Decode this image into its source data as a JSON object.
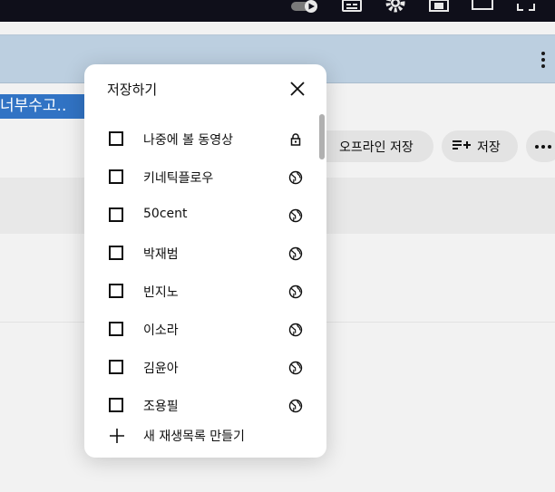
{
  "background": {
    "player_controls": [
      "miniplayer-icon",
      "subtitles-icon",
      "settings-gear-icon",
      "theater-mode-icon",
      "cast-icon",
      "fullscreen-icon"
    ],
    "video_title_fragment": "너부수고..",
    "chips": {
      "offline_save": "오프라인 저장",
      "save": "저장"
    }
  },
  "dialog": {
    "title": "저장하기",
    "close_icon": "close-icon",
    "playlists": [
      {
        "label": "나중에 볼 동영상",
        "checked": false,
        "privacy_icon": "lock-icon"
      },
      {
        "label": "키네틱플로우",
        "checked": false,
        "privacy_icon": "globe-icon"
      },
      {
        "label": "50cent",
        "checked": false,
        "privacy_icon": "globe-icon"
      },
      {
        "label": "박재범",
        "checked": false,
        "privacy_icon": "globe-icon"
      },
      {
        "label": "빈지노",
        "checked": false,
        "privacy_icon": "globe-icon"
      },
      {
        "label": "이소라",
        "checked": false,
        "privacy_icon": "globe-icon"
      },
      {
        "label": "김윤아",
        "checked": false,
        "privacy_icon": "globe-icon"
      },
      {
        "label": "조용필",
        "checked": false,
        "privacy_icon": "globe-icon"
      }
    ],
    "create_label": "새 재생목록 만들기"
  },
  "colors": {
    "dialog_bg": "#ffffff",
    "highlight": "#3173c4",
    "info_panel": "#bccfe0",
    "chip_bg": "#e3e3e3"
  }
}
